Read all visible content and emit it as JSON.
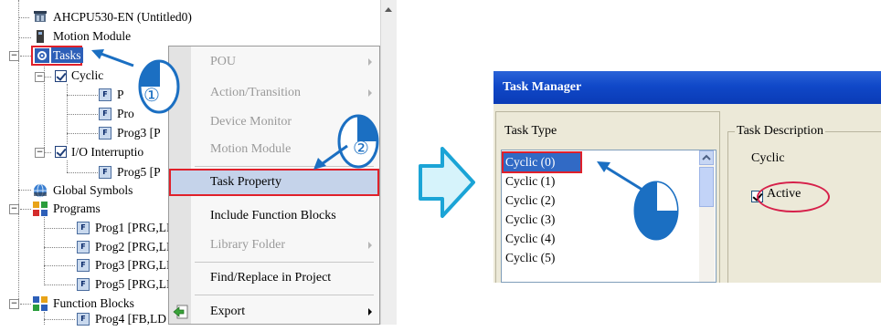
{
  "tree": {
    "items": [
      {
        "label": "AHCPU530-EN  (Untitled0)",
        "icon": "cpu-icon"
      },
      {
        "label": "Motion Module",
        "icon": "module-icon"
      },
      {
        "label": "Tasks",
        "icon": "tasks-gear-icon"
      },
      {
        "label": "Cyclic",
        "icon": "checkbox-checked-icon"
      },
      {
        "label": "P",
        "icon": "pou-icon"
      },
      {
        "label": "Pro",
        "icon": "pou-icon"
      },
      {
        "label": "Prog3 [P",
        "icon": "pou-icon"
      },
      {
        "label": "I/O Interruptio",
        "icon": "checkbox-checked-icon"
      },
      {
        "label": "Prog5 [P",
        "icon": "pou-icon"
      },
      {
        "label": "Global Symbols",
        "icon": "globe-icon"
      },
      {
        "label": "Programs",
        "icon": "programs-icon"
      },
      {
        "label": "Prog1 [PRG,LI",
        "icon": "pou-icon"
      },
      {
        "label": "Prog2 [PRG,LI",
        "icon": "pou-icon"
      },
      {
        "label": "Prog3 [PRG,LI",
        "icon": "pou-icon"
      },
      {
        "label": "Prog5 [PRG,LI",
        "icon": "pou-icon"
      },
      {
        "label": "Function Blocks",
        "icon": "function-blocks-icon"
      },
      {
        "label": "Prog4 [FB,LD",
        "icon": "pou-icon"
      }
    ]
  },
  "context_menu": {
    "items": [
      {
        "label": "POU",
        "disabled": true,
        "submenu": true
      },
      {
        "label": "Action/Transition",
        "disabled": true,
        "submenu": true
      },
      {
        "label": "Device Monitor",
        "disabled": true,
        "submenu": false
      },
      {
        "label": "Motion Module",
        "disabled": true,
        "submenu": false
      },
      {
        "label": "Task Property",
        "disabled": false,
        "submenu": false,
        "selected": true
      },
      {
        "label": "Include Function Blocks",
        "disabled": false,
        "submenu": false
      },
      {
        "label": "Library Folder",
        "disabled": true,
        "submenu": true
      },
      {
        "label": "Find/Replace in Project",
        "disabled": false,
        "submenu": false
      },
      {
        "label": "Export",
        "disabled": false,
        "submenu": true,
        "icon": "export-icon"
      }
    ]
  },
  "callouts": {
    "step1": "①",
    "step2": "②"
  },
  "task_manager": {
    "title": "Task Manager",
    "task_type_label": "Task Type",
    "task_types": [
      "Cyclic (0)",
      "Cyclic (1)",
      "Cyclic (2)",
      "Cyclic (3)",
      "Cyclic (4)",
      "Cyclic (5)"
    ],
    "selected_index": 0,
    "task_description_label": "Task Description",
    "description_value": "Cyclic",
    "active_label": "Active",
    "active_checked": true
  },
  "colors": {
    "highlight_red": "#e0202a",
    "selection_blue": "#316ac5",
    "titlebar_blue": "#0a3bb6",
    "arrow_fill": "#d6f3fb",
    "arrow_stroke": "#1ba4d6",
    "mouse_blue": "#1b6fc2"
  }
}
